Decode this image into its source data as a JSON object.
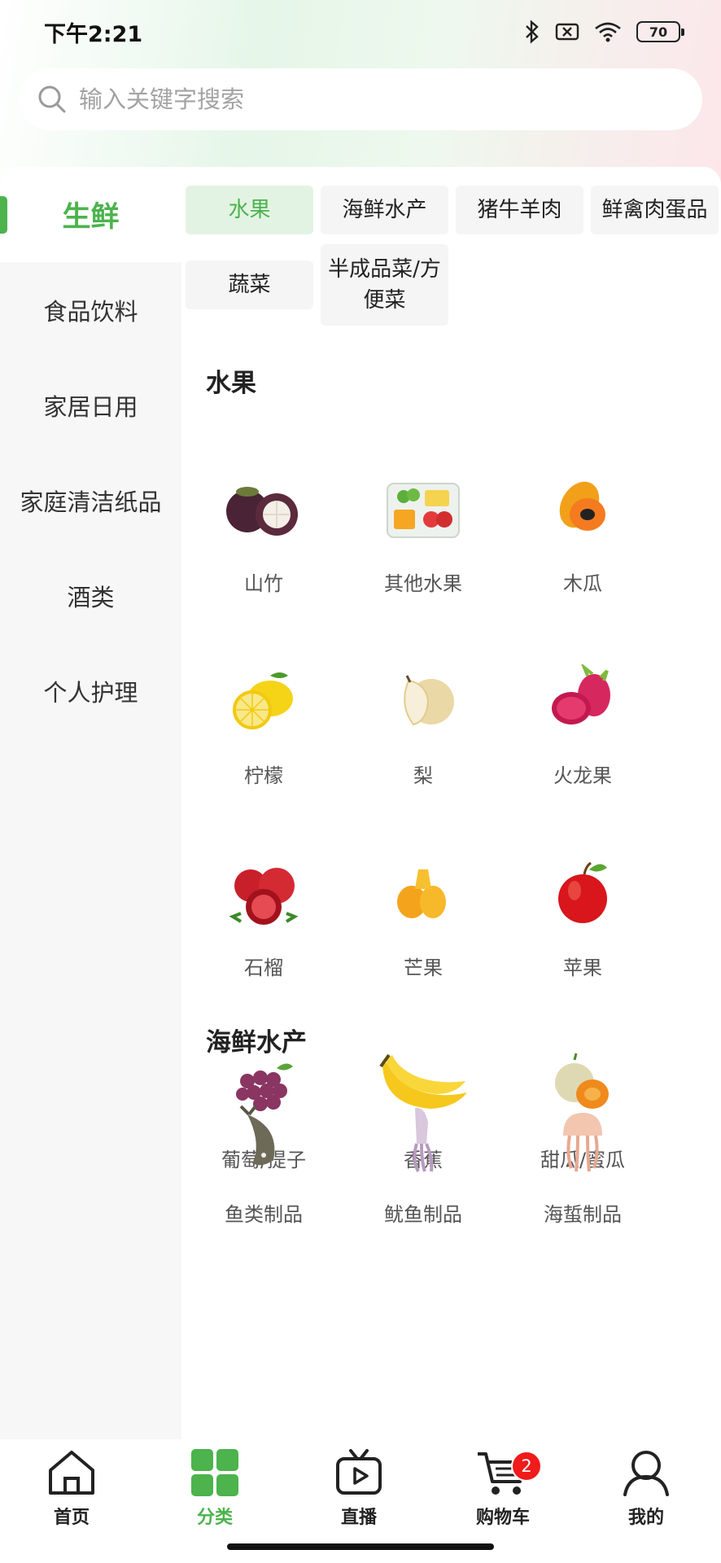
{
  "status": {
    "time": "下午2:21",
    "battery": "70"
  },
  "search": {
    "placeholder": "输入关键字搜索"
  },
  "sidebar": {
    "items": [
      {
        "label": "生鲜"
      },
      {
        "label": "食品饮料"
      },
      {
        "label": "家居日用"
      },
      {
        "label": "家庭清洁纸品"
      },
      {
        "label": "酒类"
      },
      {
        "label": "个人护理"
      }
    ]
  },
  "subtabs": [
    {
      "label": "水果"
    },
    {
      "label": "海鲜水产"
    },
    {
      "label": "猪牛羊肉"
    },
    {
      "label": "鲜禽肉蛋品"
    },
    {
      "label": "蔬菜"
    },
    {
      "label": "半成品菜/方便菜"
    }
  ],
  "sections": [
    {
      "title": "水果",
      "items": [
        {
          "label": "山竹",
          "icon": "mangosteen-icon"
        },
        {
          "label": "其他水果",
          "icon": "fruit-platter-icon"
        },
        {
          "label": "木瓜",
          "icon": "papaya-icon"
        },
        {
          "label": "柠檬",
          "icon": "lemon-icon"
        },
        {
          "label": "梨",
          "icon": "pear-icon"
        },
        {
          "label": "火龙果",
          "icon": "dragon-fruit-icon"
        },
        {
          "label": "石榴",
          "icon": "pomegranate-icon"
        },
        {
          "label": "芒果",
          "icon": "mango-icon"
        },
        {
          "label": "苹果",
          "icon": "apple-icon"
        },
        {
          "label": "葡萄/提子",
          "icon": "grape-icon"
        },
        {
          "label": "香蕉",
          "icon": "banana-icon"
        },
        {
          "label": "甜瓜/蜜瓜",
          "icon": "melon-icon"
        }
      ]
    },
    {
      "title": "海鲜水产",
      "items": [
        {
          "label": "鱼类制品",
          "icon": "fish-icon"
        },
        {
          "label": "鱿鱼制品",
          "icon": "squid-icon"
        },
        {
          "label": "海蜇制品",
          "icon": "jellyfish-icon"
        }
      ]
    }
  ],
  "tabbar": {
    "items": [
      {
        "label": "首页",
        "icon": "home-icon"
      },
      {
        "label": "分类",
        "icon": "category-icon"
      },
      {
        "label": "直播",
        "icon": "live-icon"
      },
      {
        "label": "购物车",
        "icon": "cart-icon",
        "badge": "2"
      },
      {
        "label": "我的",
        "icon": "profile-icon"
      }
    ]
  },
  "colors": {
    "accent": "#4cb34d",
    "badge": "#f01b1b"
  }
}
